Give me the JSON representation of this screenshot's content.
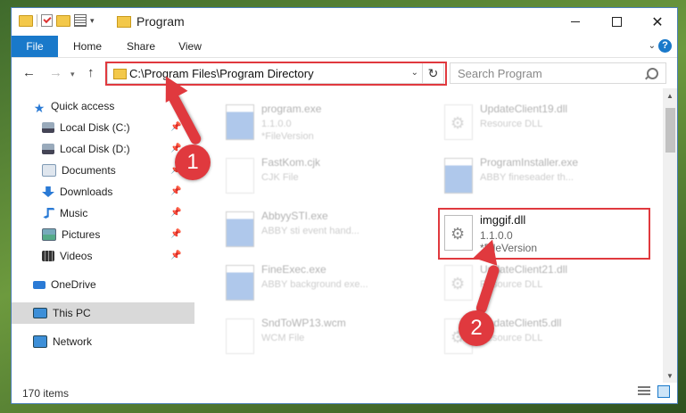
{
  "window": {
    "title": "Program"
  },
  "ribbon": {
    "tabs": [
      "File",
      "Home",
      "Share",
      "View"
    ],
    "help": "?"
  },
  "address": {
    "path": "C:\\Program Files\\Program Directory",
    "refresh": "↻"
  },
  "search": {
    "placeholder": "Search Program"
  },
  "navpane": {
    "items": [
      {
        "label": "Quick access"
      },
      {
        "label": "Local Disk (C:)"
      },
      {
        "label": "Local Disk (D:)"
      },
      {
        "label": "Documents"
      },
      {
        "label": "Downloads"
      },
      {
        "label": "Music"
      },
      {
        "label": "Pictures"
      },
      {
        "label": "Videos"
      },
      {
        "label": "OneDrive"
      },
      {
        "label": "This PC"
      },
      {
        "label": "Network"
      }
    ]
  },
  "files": [
    {
      "name": "program.exe",
      "line2": "1.1.0.0",
      "line3": "*FileVersion"
    },
    {
      "name": "UpdateClient19.dll",
      "line2": "Resource DLL",
      "line3": ""
    },
    {
      "name": "FastKom.cjk",
      "line2": "CJK File",
      "line3": ""
    },
    {
      "name": "ProgramInstaller.exe",
      "line2": "ABBY fineseader th...",
      "line3": ""
    },
    {
      "name": "AbbyySTI.exe",
      "line2": "ABBY sti event hand...",
      "line3": ""
    },
    {
      "name": "imggif.dll",
      "line2": "1.1.0.0",
      "line3": "*FileVersion"
    },
    {
      "name": "FineExec.exe",
      "line2": "ABBY background exe...",
      "line3": ""
    },
    {
      "name": "UpdateClient21.dll",
      "line2": "Resource DLL",
      "line3": ""
    },
    {
      "name": "SndToWP13.wcm",
      "line2": "WCM File",
      "line3": ""
    },
    {
      "name": "UpdateClient5.dll",
      "line2": "Resource DLL",
      "line3": ""
    }
  ],
  "statusbar": {
    "item_count": "170 items"
  },
  "annotations": {
    "step1": "1",
    "step2": "2",
    "accent_color": "#e0393e"
  },
  "icons": [
    "folder-icon",
    "properties-icon",
    "back-arrow-icon",
    "forward-arrow-icon",
    "up-arrow-icon",
    "refresh-icon",
    "search-icon",
    "pin-icon",
    "gear-dll-icon",
    "exe-icon"
  ]
}
